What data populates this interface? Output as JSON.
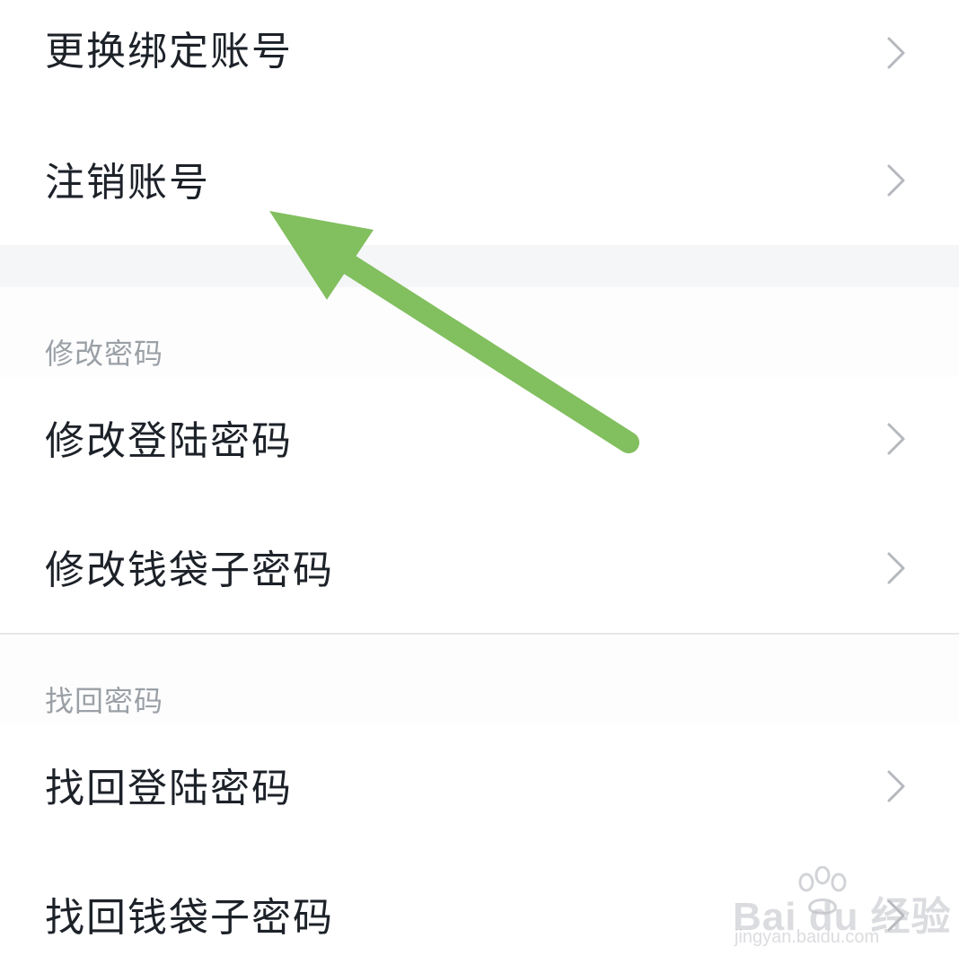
{
  "settings": {
    "top_items": [
      {
        "label": "更换绑定账号"
      },
      {
        "label": "注销账号"
      }
    ],
    "sections": [
      {
        "header": "修改密码",
        "items": [
          {
            "label": "修改登陆密码"
          },
          {
            "label": "修改钱袋子密码"
          }
        ]
      },
      {
        "header": "找回密码",
        "items": [
          {
            "label": "找回登陆密码"
          },
          {
            "label": "找回钱袋子密码"
          }
        ]
      }
    ]
  },
  "annotation": {
    "type": "arrow",
    "color": "#82bf5f",
    "points_to": "注销账号"
  },
  "watermark": {
    "brand": "Bai du 经验",
    "url": "jingyan.baidu.com"
  },
  "colors": {
    "text": "#1d2229",
    "section_header": "#9aa0a6",
    "chevron": "#b5b8bd",
    "gap": "#f5f6f8",
    "divider": "#e6e7ea"
  }
}
